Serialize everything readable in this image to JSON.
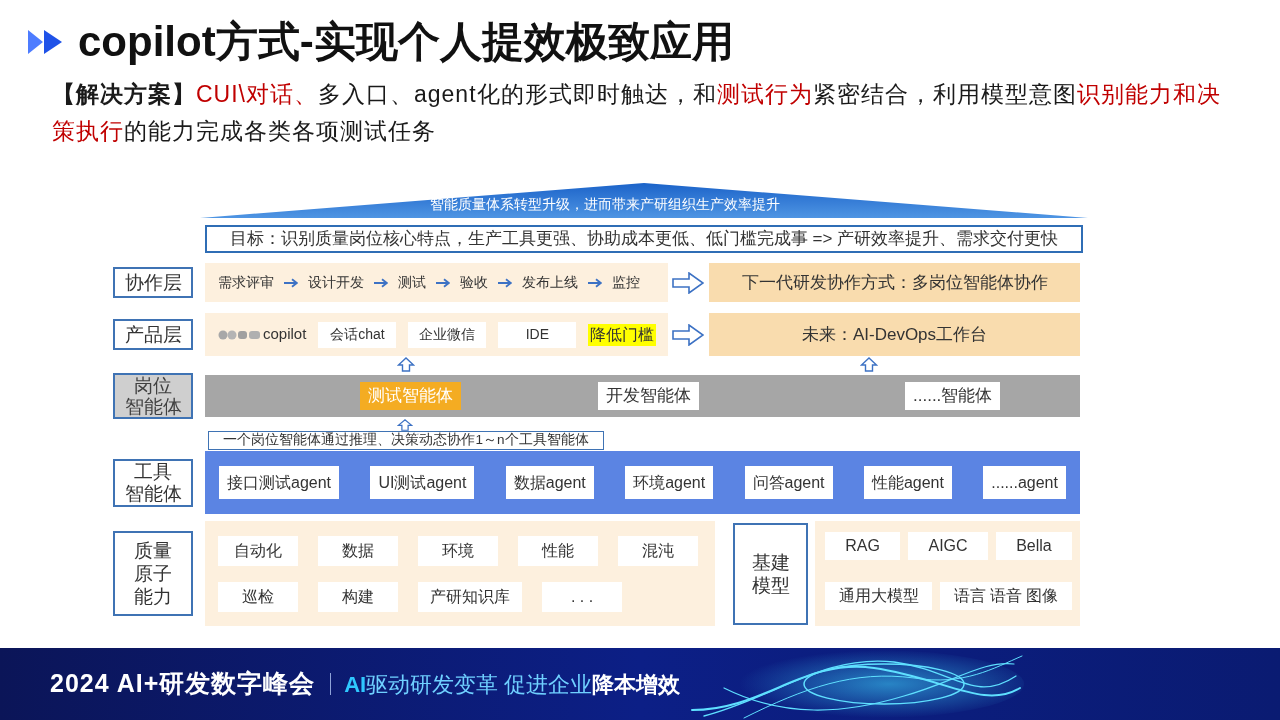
{
  "header": {
    "title": "copilot方式-实现个人提效极致应用"
  },
  "description": [
    {
      "kind": "bold",
      "text": "【解决方案】"
    },
    {
      "kind": "red",
      "text": "CUI\\对话、"
    },
    {
      "kind": "plain",
      "text": "多入口、agent化的形式即时触达，和"
    },
    {
      "kind": "red",
      "text": "测试行为"
    },
    {
      "kind": "plain",
      "text": "紧密结合，利用模型意图"
    },
    {
      "kind": "red",
      "text": "识别能力和决策执行"
    },
    {
      "kind": "plain",
      "text": "的能力完成各类各项测试任务"
    }
  ],
  "diagram": {
    "roof": "智能质量体系转型升级，进而带来产研组织生产效率提升",
    "goal": "目标：识别质量岗位核心特点，生产工具更强、协助成本更低、低门槛完成事 => 产研效率提升、需求交付更快",
    "layers": [
      {
        "kind": "flow",
        "label": [
          "协作层"
        ],
        "steps": [
          "需求评审",
          "设计开发",
          "测试",
          "验收",
          "发布上线",
          "监控"
        ],
        "outcome": "下一代研发协作方式：多岗位智能体协作"
      },
      {
        "kind": "products",
        "label": [
          "产品层"
        ],
        "items": [
          {
            "kind": "logo",
            "text": "copilot"
          },
          {
            "kind": "box",
            "text": "会话chat"
          },
          {
            "kind": "box",
            "text": "企业微信"
          },
          {
            "kind": "box",
            "text": "IDE"
          },
          {
            "kind": "highlight",
            "text": "降低门槛"
          }
        ],
        "outcome": "未来：AI-DevOps工作台"
      },
      {
        "kind": "roles",
        "label": [
          "岗位",
          "智能体"
        ],
        "items": [
          {
            "text": "测试智能体",
            "highlighted": true
          },
          {
            "text": "开发智能体",
            "highlighted": false
          },
          {
            "text": "......智能体",
            "highlighted": false
          }
        ]
      },
      {
        "kind": "tools",
        "label": [
          "工具",
          "智能体"
        ],
        "note": "一个岗位智能体通过推理、决策动态协作1～n个工具智能体",
        "items": [
          "接口测试agent",
          "UI测试agent",
          "数据agent",
          "环境agent",
          "问答agent",
          "性能agent",
          "......agent"
        ]
      },
      {
        "kind": "atoms",
        "label": [
          "质量",
          "原子",
          "能力"
        ],
        "capabilities": [
          [
            "自动化",
            "数据",
            "环境",
            "性能",
            "混沌"
          ],
          [
            "巡检",
            "构建",
            "产研知识库",
            ". . ."
          ]
        ],
        "infra_label": [
          "基建",
          "模型"
        ],
        "models": [
          [
            "RAG",
            "AIGC",
            "Bella"
          ],
          [
            "通用大模型",
            "语言 语音 图像"
          ]
        ]
      }
    ]
  },
  "footer": {
    "event": "2024 AI+研发数字峰会",
    "slogan": [
      {
        "kind": "accent",
        "text": "AI"
      },
      {
        "kind": "plain",
        "text": "驱动研发变革 促进企业"
      },
      {
        "kind": "strong",
        "text": "降本增效"
      }
    ]
  }
}
